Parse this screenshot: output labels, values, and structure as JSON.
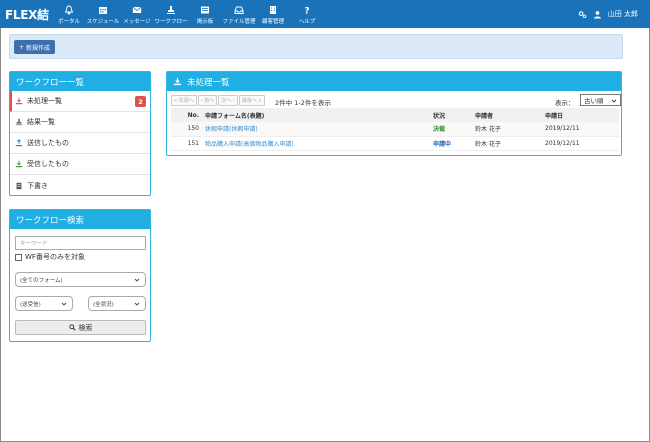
{
  "app": {
    "logo": "FLEX結"
  },
  "nav": [
    {
      "label": "ポータル",
      "icon": "bell-icon"
    },
    {
      "label": "スケジュール",
      "icon": "calendar-icon"
    },
    {
      "label": "メッセージ",
      "icon": "envelope-icon"
    },
    {
      "label": "ワークフロー",
      "icon": "stamp-icon"
    },
    {
      "label": "掲示板",
      "icon": "board-icon"
    },
    {
      "label": "ファイル管理",
      "icon": "inbox-icon"
    },
    {
      "label": "顧客管理",
      "icon": "building-icon"
    },
    {
      "label": "ヘルプ",
      "icon": "question-icon"
    }
  ],
  "user": {
    "name": "山田 太郎"
  },
  "toolbar": {
    "new_label": "新規作成"
  },
  "workflow_panel": {
    "title": "ワークフロー一覧",
    "items": [
      {
        "label": "未処理一覧",
        "badge": "2",
        "icon": "download-red-icon"
      },
      {
        "label": "結果一覧",
        "icon": "stamp-gray-icon"
      },
      {
        "label": "送信したもの",
        "icon": "upload-blue-icon"
      },
      {
        "label": "受信したもの",
        "icon": "download-green-icon"
      },
      {
        "label": "下書き",
        "icon": "draft-icon"
      }
    ]
  },
  "search_panel": {
    "title": "ワークフロー検索",
    "keyword_placeholder": "キーワード",
    "checkbox_label": "WF番号のみを対象",
    "form_select": "(全てのフォーム)",
    "direction_select": "(送受信)",
    "status_select": "(全状況)",
    "search_label": "検索"
  },
  "pending_panel": {
    "title": "未処理一覧",
    "pager": {
      "first": "« 先頭へ",
      "prev": "‹ 前へ",
      "next": "次へ ›",
      "last": "最後へ »"
    },
    "count": "2件中 1-2件を表示",
    "display_label": "表示：",
    "sort_value": "古い順",
    "columns": {
      "no": "No.",
      "form": "申請フォーム名(表題)",
      "status": "状況",
      "applicant": "申請者",
      "date": "申請日"
    },
    "rows": [
      {
        "no": "150",
        "form": "休暇申請(休暇申請)",
        "status": "決裁",
        "applicant": "鈴木 花子",
        "date": "2019/12/11"
      },
      {
        "no": "151",
        "form": "物品購入申請(高価物品購入申請)",
        "status": "申請中",
        "applicant": "鈴木 花子",
        "date": "2019/12/11"
      }
    ]
  },
  "colors": {
    "header": "#1a73b8",
    "panel": "#21aee2",
    "badge": "#d9534f",
    "approved": "#2e8f2e",
    "applying": "#2567b8"
  }
}
